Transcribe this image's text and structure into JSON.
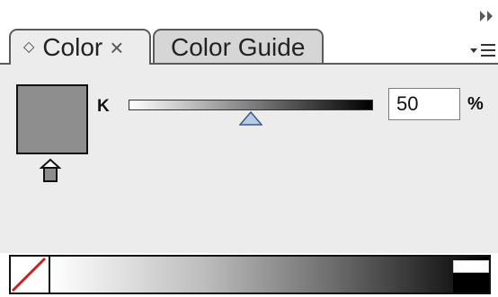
{
  "panel": {
    "tabs": [
      {
        "label": "Color",
        "active": true
      },
      {
        "label": "Color Guide",
        "active": false
      }
    ],
    "tab_close_glyph": "×",
    "tab_updown_glyph": "◇"
  },
  "color": {
    "channel_label": "K",
    "value": "50",
    "unit": "%",
    "fill_color": "#8e8e8e",
    "slider_level_percent": 50
  },
  "icons": {
    "collapse": "double-arrow-right-icon",
    "panel_menu": "panel-menu-icon",
    "out_of_gamut": "out-of-web-color-warning-icon",
    "none_swatch": "none-swatch-icon"
  },
  "ramp": {
    "start_color": "#ffffff",
    "end_color": "#000000"
  }
}
